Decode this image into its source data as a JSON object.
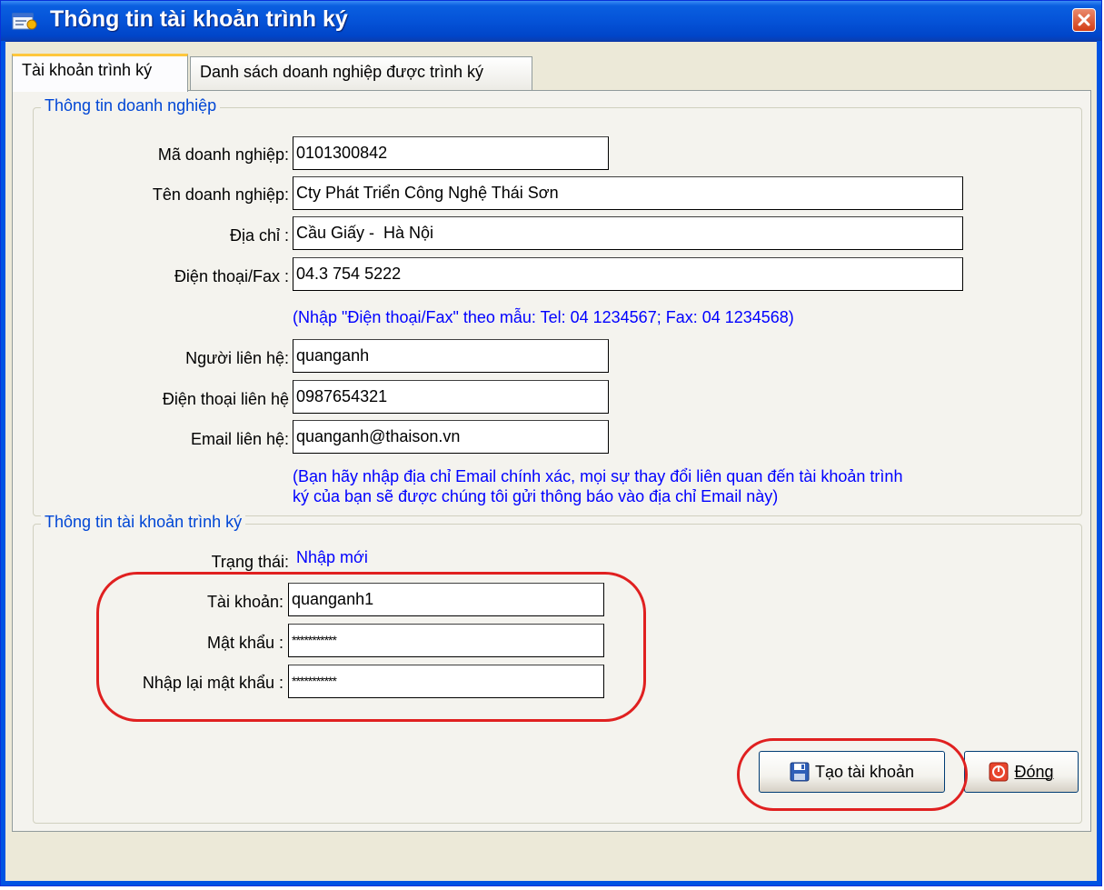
{
  "window": {
    "title": "Thông tin tài khoản trình ký"
  },
  "tabs": [
    {
      "label": "Tài khoản trình ký",
      "active": true
    },
    {
      "label": "Danh sách doanh nghiệp được trình ký",
      "active": false
    }
  ],
  "company_group": {
    "legend": "Thông tin doanh nghiệp",
    "fields": {
      "ma_dn": {
        "label": "Mã doanh nghiệp:",
        "value": "0101300842"
      },
      "ten_dn": {
        "label": "Tên doanh nghiệp:",
        "value": "Cty Phát Triển Công Nghệ Thái Sơn"
      },
      "dia_chi": {
        "label": "Địa chỉ :",
        "value": "Cầu Giấy -  Hà Nội"
      },
      "dien_thoai_fax": {
        "label": "Điện thoại/Fax :",
        "value": "04.3 754 5222"
      },
      "nguoi_lien_he": {
        "label": "Người liên hệ:",
        "value": "quanganh"
      },
      "dien_thoai_lien_he": {
        "label": "Điện thoại liên hệ",
        "value": "0987654321"
      },
      "email_lien_he": {
        "label": "Email liên hệ:",
        "value": "quanganh@thaison.vn"
      }
    },
    "phone_hint": "(Nhập \"Điện thoại/Fax\" theo mẫu: Tel: 04 1234567; Fax: 04 1234568)",
    "email_hint_line1": "(Bạn hãy nhập địa chỉ Email chính xác, mọi sự thay đổi liên quan đến tài khoản trình",
    "email_hint_line2": "ký của bạn sẽ được chúng tôi gửi thông báo vào địa chỉ Email này)"
  },
  "account_group": {
    "legend": "Thông tin tài khoản trình ký",
    "status_label": "Trạng thái:",
    "status_value": "Nhập mới",
    "fields": {
      "tai_khoan": {
        "label": "Tài khoản:",
        "value": "quanganh1"
      },
      "mat_khau": {
        "label": "Mật khẩu :",
        "value": "***********"
      },
      "nhap_lai": {
        "label": "Nhập lại mật khẩu :",
        "value": "***********"
      }
    }
  },
  "buttons": {
    "create": "Tạo tài khoản",
    "close": "Đóng"
  },
  "colors": {
    "title_bar": "#0553d8",
    "hint_text": "#0000ff",
    "legend_text": "#0046d5",
    "annotation": "#e02020"
  }
}
